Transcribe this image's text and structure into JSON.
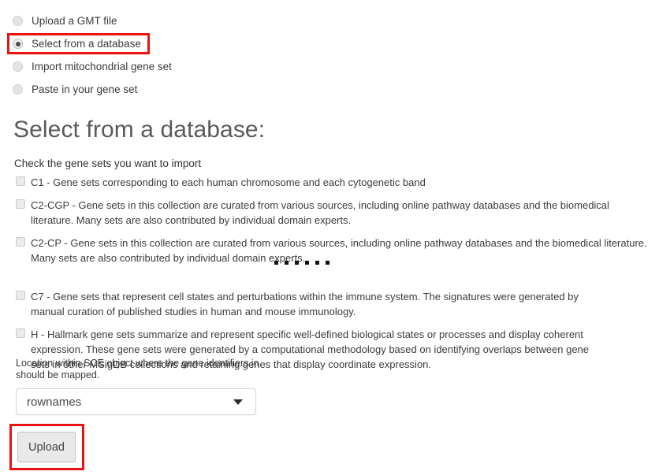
{
  "source_options": {
    "items": [
      {
        "label": "Upload a GMT file",
        "selected": false
      },
      {
        "label": "Select from a database",
        "selected": true
      },
      {
        "label": "Import mitochondrial gene set",
        "selected": false
      },
      {
        "label": "Paste in your gene set",
        "selected": false
      }
    ]
  },
  "section": {
    "heading": "Select from a database:",
    "instruction": "Check the gene sets you want to import"
  },
  "gene_sets": [
    {
      "id": "C1",
      "label": "C1 - Gene sets corresponding to each human chromosome and each cytogenetic band",
      "checked": false
    },
    {
      "id": "C2-CGP",
      "label": "C2-CGP - Gene sets in this collection are curated from various sources, including online pathway databases and the biomedical literature. Many sets are also contributed by individual domain experts.",
      "checked": false
    },
    {
      "id": "C2-CP",
      "label": "C2-CP - Gene sets in this collection are curated from various sources, including online pathway databases and the biomedical literature. Many sets are also contributed by individual domain experts.",
      "checked": false
    },
    {
      "id": "C7",
      "label": "C7 - Gene sets that represent cell states and perturbations within the immune system. The signatures were generated by manual curation of published studies in human and mouse immunology.",
      "checked": false
    },
    {
      "id": "H",
      "label": "H - Hallmark gene sets summarize and represent specific well-defined biological states or processes and display coherent expression. These gene sets were generated by a computational methodology based on identifying overlaps between gene sets in other MSigDB collections and retaining genes that display coordinate expression.",
      "checked": false
    }
  ],
  "truncation_indicator": {
    "dot_count": 6
  },
  "location_field": {
    "caption": "Location within SCE object where the gene identifiers in should be mapped.",
    "selected_value": "rownames"
  },
  "actions": {
    "upload_label": "Upload"
  },
  "annotations": {
    "highlight_color": "#ee1111",
    "targets": [
      "select-from-a-database-radio",
      "upload-button"
    ]
  }
}
